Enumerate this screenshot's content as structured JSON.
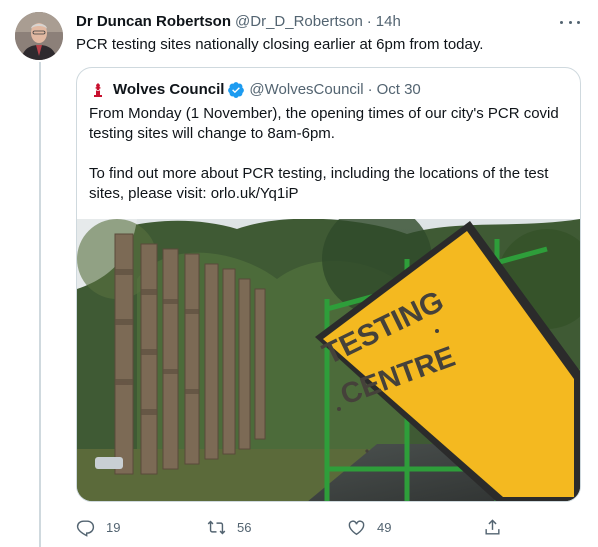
{
  "tweet": {
    "author_name": "Dr Duncan Robertson",
    "author_handle": "@Dr_D_Robertson",
    "separator": "·",
    "time": "14h",
    "text": "PCR testing sites nationally closing earlier at 6pm from today."
  },
  "quote": {
    "author_name": "Wolves Council",
    "author_handle": "@WolvesCouncil",
    "separator": "·",
    "time": "Oct 30",
    "paragraph_1": "From Monday (1 November), the opening times of our city's PCR covid testing sites will change to 8am-6pm.",
    "paragraph_2": "To find out more about PCR testing, including the locations of the test sites, please visit: orlo.uk/Yq1iP",
    "photo": {
      "sign_line_1": "TESTING",
      "sign_line_2": "CENTRE"
    }
  },
  "actions": {
    "replies": "19",
    "retweets": "56",
    "likes": "49"
  },
  "colors": {
    "text": "#0f1419",
    "muted": "#536471",
    "border": "#cfd9de",
    "verified": "#1d9bf0",
    "sign_yellow": "#f4b920"
  }
}
